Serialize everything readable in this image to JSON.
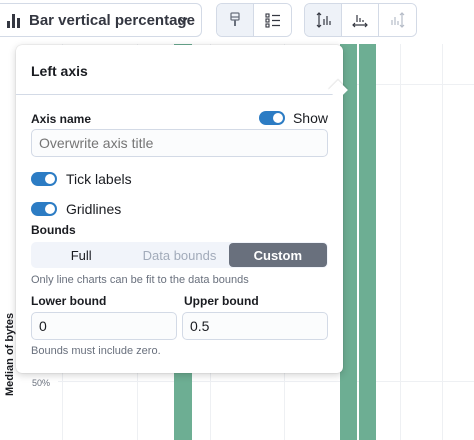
{
  "toolbar": {
    "chart_type_label": "Bar vertical percentage",
    "buttons_left": [
      {
        "icon": "paintbrush-icon"
      },
      {
        "icon": "list-icon"
      }
    ],
    "buttons_right": [
      {
        "icon": "left-axis-icon"
      },
      {
        "icon": "bottom-axis-icon"
      },
      {
        "icon": "right-axis-icon"
      }
    ]
  },
  "chart": {
    "y_axis_title": "Median of bytes",
    "y_tick_label": "50%",
    "bar_color": "#6dae93"
  },
  "popover": {
    "title": "Left axis",
    "axis_name_label": "Axis name",
    "show_label": "Show",
    "axis_title_placeholder": "Overwrite axis title",
    "tick_labels_label": "Tick labels",
    "gridlines_label": "Gridlines",
    "bounds_label": "Bounds",
    "bounds_options": [
      {
        "label": "Full",
        "state": "normal"
      },
      {
        "label": "Data bounds",
        "state": "disabled"
      },
      {
        "label": "Custom",
        "state": "selected"
      }
    ],
    "bounds_help": "Only line charts can be fit to the data bounds",
    "lower_bound_label": "Lower bound",
    "lower_bound_value": "0",
    "upper_bound_label": "Upper bound",
    "upper_bound_value": "0.5",
    "bounds_footer": "Bounds must include zero."
  },
  "colors": {
    "accent": "#2c7cc4",
    "selected_segment": "#69707d"
  }
}
